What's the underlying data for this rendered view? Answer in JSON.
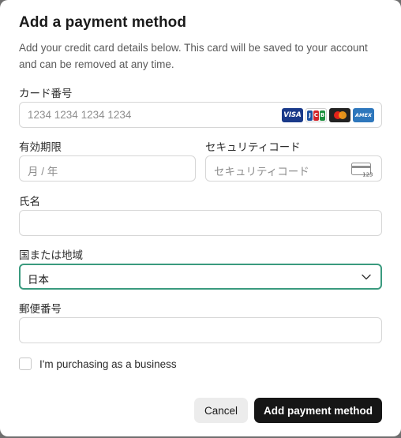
{
  "dialog": {
    "title": "Add a payment method",
    "description": "Add your credit card details below. This card will be saved to your account and can be removed at any time."
  },
  "card_number": {
    "label": "カード番号",
    "placeholder": "1234 1234 1234 1234",
    "brands": [
      "VISA",
      "JCB",
      "Mastercard",
      "AMEX"
    ],
    "visa_text": "VISA",
    "jcb_letters": [
      "J",
      "C",
      "B"
    ],
    "amex_text": "AMEX"
  },
  "expiry": {
    "label": "有効期限",
    "placeholder": "月 / 年"
  },
  "security_code": {
    "label": "セキュリティコード",
    "placeholder": "セキュリティコード",
    "icon_text": "123"
  },
  "name": {
    "label": "氏名",
    "value": ""
  },
  "country": {
    "label": "国または地域",
    "value": "日本"
  },
  "postal_code": {
    "label": "郵便番号",
    "value": ""
  },
  "business": {
    "label": "I'm purchasing as a business",
    "checked": false
  },
  "actions": {
    "cancel_label": "Cancel",
    "submit_label": "Add payment method"
  },
  "colors": {
    "focus_border": "#3a9a7e",
    "primary_button": "#161616",
    "visa": "#1a3a8a",
    "amex": "#2e77bc",
    "mastercard_red": "#e2231a",
    "mastercard_orange": "#f79e1b"
  }
}
